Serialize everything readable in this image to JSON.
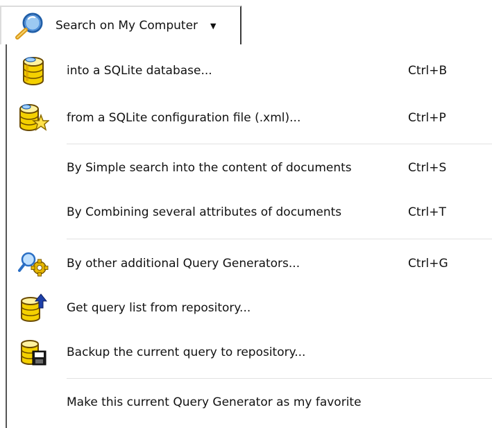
{
  "toolbar": {
    "button_label": "Search on My Computer",
    "button_icon": "magnifier-icon",
    "dropdown_glyph": "▼"
  },
  "menu": {
    "items": [
      {
        "label": "into a SQLite database...",
        "shortcut": "Ctrl+B",
        "icon": "database-icon"
      },
      {
        "label": "from a SQLite configuration file (.xml)...",
        "shortcut": "Ctrl+P",
        "icon": "database-star-icon"
      },
      {
        "label": "By Simple search into the content of documents",
        "shortcut": "Ctrl+S",
        "icon": ""
      },
      {
        "label": "By Combining several attributes of documents",
        "shortcut": "Ctrl+T",
        "icon": ""
      },
      {
        "label": "By other additional Query Generators...",
        "shortcut": "Ctrl+G",
        "icon": "query-generator-icon"
      },
      {
        "label": "Get query list from repository...",
        "shortcut": "",
        "icon": "repository-get-icon"
      },
      {
        "label": "Backup the current query to repository...",
        "shortcut": "",
        "icon": "repository-backup-icon"
      },
      {
        "label": "Make this current Query Generator as my favorite",
        "shortcut": "",
        "icon": ""
      }
    ]
  },
  "colors": {
    "db_yellow": "#f4d000",
    "db_orange": "#d89a00",
    "magnifier_blue": "#3f86d8",
    "star_yellow": "#ffe14a",
    "arrow_blue": "#1d3fa8",
    "gear_yellow": "#e8b800"
  }
}
